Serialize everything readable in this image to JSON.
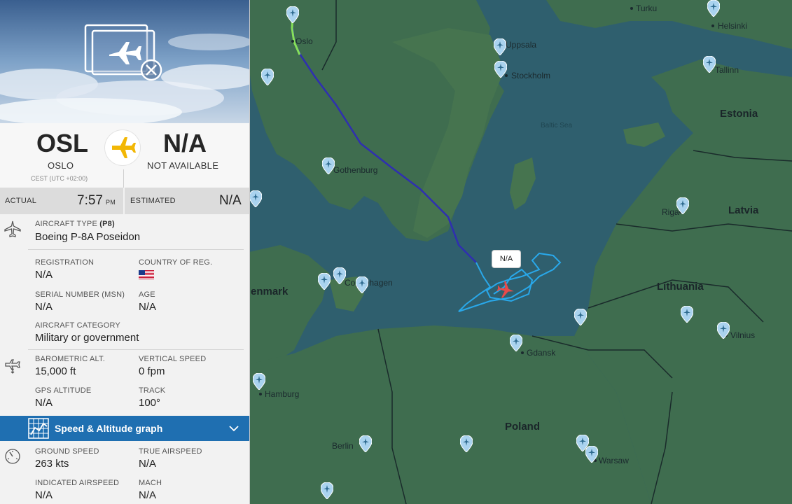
{
  "map": {
    "cities": {
      "oslo": "Oslo",
      "turku": "Turku",
      "helsinki": "Helsinki",
      "uppsala": "Uppsala",
      "stockholm": "Stockholm",
      "tallinn": "Tallinn",
      "gothenburg": "Gothenburg",
      "riga": "Riga",
      "copenhagen": "Copenhagen",
      "gdansk": "Gdansk",
      "vilnius": "Vilnius",
      "hamburg": "Hamburg",
      "berlin": "Berlin",
      "warsaw": "Warsaw"
    },
    "countries": {
      "estonia": "Estonia",
      "latvia": "Latvia",
      "lithuania": "Lithuania",
      "denmark": "enmark",
      "poland": "Poland"
    },
    "sea_label": "Baltic Sea",
    "flight_label": "N/A",
    "colors": {
      "water": "#2f5f6e",
      "land": "#3d6b4e",
      "track_blue": "#2f2fb0",
      "pattern": "#29a8ea",
      "aircraft": "#e84a4a",
      "pin": "#aad3ef"
    }
  },
  "panel": {
    "origin": {
      "code": "OSL",
      "name": "OSLO",
      "tz": "CEST (UTC +02:00)"
    },
    "destination": {
      "code": "N/A",
      "name": "NOT AVAILABLE"
    },
    "times": {
      "actual_label": "ACTUAL",
      "actual_value": "7:57",
      "actual_ampm": "PM",
      "estimated_label": "ESTIMATED",
      "estimated_value": "N/A"
    },
    "aircraft": {
      "type_label": "AIRCRAFT TYPE",
      "type_code": "(P8)",
      "type_value": "Boeing P-8A Poseidon",
      "registration_label": "REGISTRATION",
      "registration_value": "N/A",
      "country_label": "COUNTRY OF REG.",
      "msn_label": "SERIAL NUMBER (MSN)",
      "msn_value": "N/A",
      "age_label": "AGE",
      "age_value": "N/A",
      "category_label": "AIRCRAFT CATEGORY",
      "category_value": "Military or government"
    },
    "altitude": {
      "baro_label": "BAROMETRIC ALT.",
      "baro_value": "15,000 ft",
      "vs_label": "VERTICAL SPEED",
      "vs_value": "0 fpm",
      "gps_label": "GPS ALTITUDE",
      "gps_value": "N/A",
      "track_label": "TRACK",
      "track_value": "100°"
    },
    "graph_bar": {
      "label": "Speed & Altitude graph"
    },
    "speed": {
      "gs_label": "GROUND SPEED",
      "gs_value": "263 kts",
      "tas_label": "TRUE AIRSPEED",
      "tas_value": "N/A",
      "ias_label": "INDICATED AIRSPEED",
      "ias_value": "N/A",
      "mach_label": "MACH",
      "mach_value": "N/A"
    },
    "colors": {
      "accent_blue": "#1f6fb1",
      "plane_yellow": "#f2b705"
    }
  }
}
